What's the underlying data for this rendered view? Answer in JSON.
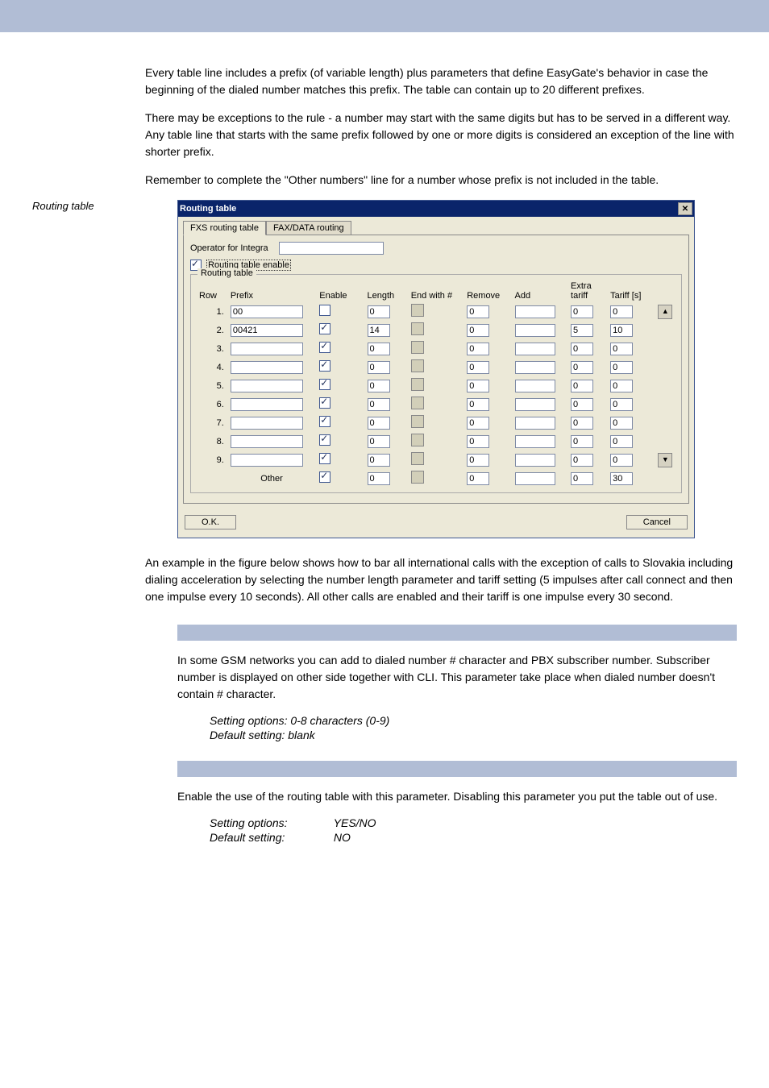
{
  "side_caption": "Routing table",
  "paragraphs": {
    "p1": "Every table line includes a prefix (of variable length) plus parameters that define EasyGate's behavior in case the beginning of the dialed number matches this prefix. The table can contain up to 20 different prefixes.",
    "p2": "There may be exceptions to the rule - a number may start with the same digits but has to be served in a different way. Any table line that starts with the same prefix followed by one or more digits is considered an exception of the line with shorter prefix.",
    "p3": "Remember to complete the \"Other numbers\" line for a number whose prefix is not included in the table.",
    "p4": "An example in the figure below shows how to bar all international calls with the exception of calls to Slovakia including dialing acceleration by selecting the number length parameter and tariff setting (5 impulses after call connect and then one impulse every 10 seconds). All other calls are enabled and their tariff is one impulse every 30 second.",
    "integra_desc": "In some GSM networks you can add to dialed number # character and PBX subscriber number. Subscriber number is displayed on other side together with CLI. This parameter take place when dialed number doesn't contain # character.",
    "integra_opts": "Setting options: 0-8 characters (0-9)",
    "integra_def": "Default setting: blank",
    "enable_desc": "Enable the use of the routing table with this parameter. Disabling this parameter you put the table out of use.",
    "enable_opts_label": "Setting options:",
    "enable_opts_val": "YES/NO",
    "enable_def_label": "Default setting:",
    "enable_def_val": "NO"
  },
  "dialog": {
    "title": "Routing table",
    "tab1": "FXS routing table",
    "tab2": "FAX/DATA routing",
    "operator_label": "Operator for Integra",
    "operator_value": "",
    "enable_label": "Routing table enable",
    "group_label": "Routing table",
    "headers": {
      "row": "Row",
      "prefix": "Prefix",
      "enable": "Enable",
      "length": "Length",
      "endwith": "End with #",
      "remove": "Remove",
      "add": "Add",
      "extra": "Extra tariff",
      "tariff": "Tariff [s]"
    },
    "rows": [
      {
        "n": "1.",
        "prefix": "00",
        "enable": false,
        "length": "0",
        "endwith": false,
        "remove": "0",
        "add": "",
        "extra": "0",
        "tariff": "0"
      },
      {
        "n": "2.",
        "prefix": "00421",
        "enable": true,
        "length": "14",
        "endwith": false,
        "remove": "0",
        "add": "",
        "extra": "5",
        "tariff": "10"
      },
      {
        "n": "3.",
        "prefix": "",
        "enable": true,
        "length": "0",
        "endwith": false,
        "remove": "0",
        "add": "",
        "extra": "0",
        "tariff": "0"
      },
      {
        "n": "4.",
        "prefix": "",
        "enable": true,
        "length": "0",
        "endwith": false,
        "remove": "0",
        "add": "",
        "extra": "0",
        "tariff": "0"
      },
      {
        "n": "5.",
        "prefix": "",
        "enable": true,
        "length": "0",
        "endwith": false,
        "remove": "0",
        "add": "",
        "extra": "0",
        "tariff": "0"
      },
      {
        "n": "6.",
        "prefix": "",
        "enable": true,
        "length": "0",
        "endwith": false,
        "remove": "0",
        "add": "",
        "extra": "0",
        "tariff": "0"
      },
      {
        "n": "7.",
        "prefix": "",
        "enable": true,
        "length": "0",
        "endwith": false,
        "remove": "0",
        "add": "",
        "extra": "0",
        "tariff": "0"
      },
      {
        "n": "8.",
        "prefix": "",
        "enable": true,
        "length": "0",
        "endwith": false,
        "remove": "0",
        "add": "",
        "extra": "0",
        "tariff": "0"
      },
      {
        "n": "9.",
        "prefix": "",
        "enable": true,
        "length": "0",
        "endwith": false,
        "remove": "0",
        "add": "",
        "extra": "0",
        "tariff": "0"
      }
    ],
    "other_label": "Other",
    "other": {
      "enable": true,
      "length": "0",
      "endwith": false,
      "remove": "0",
      "add": "",
      "extra": "0",
      "tariff": "30"
    },
    "ok": "O.K.",
    "cancel": "Cancel"
  }
}
